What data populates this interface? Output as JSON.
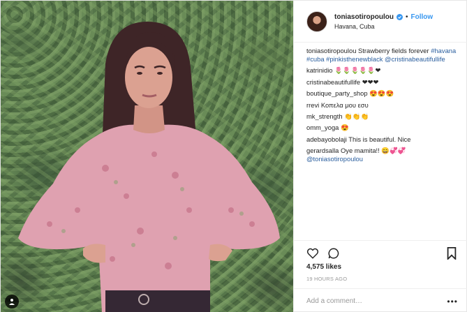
{
  "post": {
    "username": "toniasotiropoulou",
    "follow_label": "Follow",
    "separator": "•",
    "location": "Havana, Cuba",
    "accent_color": "#3897f0"
  },
  "comments": [
    {
      "user": "toniasotiropoulou",
      "text": " Strawberry fields forever ",
      "tags": "#havana #cuba #pinkisthenewblack @cristinabeautifullife"
    },
    {
      "user": "katrinidio",
      "text": " 🌷🌷🌷🌷🌷❤"
    },
    {
      "user": "cristinabeautifullife",
      "text": " ❤❤❤"
    },
    {
      "user": "boutique_party_shop",
      "text": " 😍😍😍"
    },
    {
      "user": "rrevi",
      "text": " Κοπελα μου εσυ"
    },
    {
      "user": "mk_strength",
      "text": " 👏👏👏"
    },
    {
      "user": "omm_yoga",
      "text": " 😍"
    },
    {
      "user": "adebayobolaji",
      "text": " This is beautiful. Nice"
    },
    {
      "user": "gerardsalla",
      "text": " Oye mamita!! 😄💞💞 ",
      "tags": "@toniasotiropoulou"
    }
  ],
  "actions": {
    "icons": [
      "heart-icon",
      "comment-icon",
      "bookmark-icon"
    ]
  },
  "likes": "4,575 likes",
  "timestamp": "19 HOURS AGO",
  "add_comment_placeholder": "Add a comment…",
  "more_label": "•••"
}
